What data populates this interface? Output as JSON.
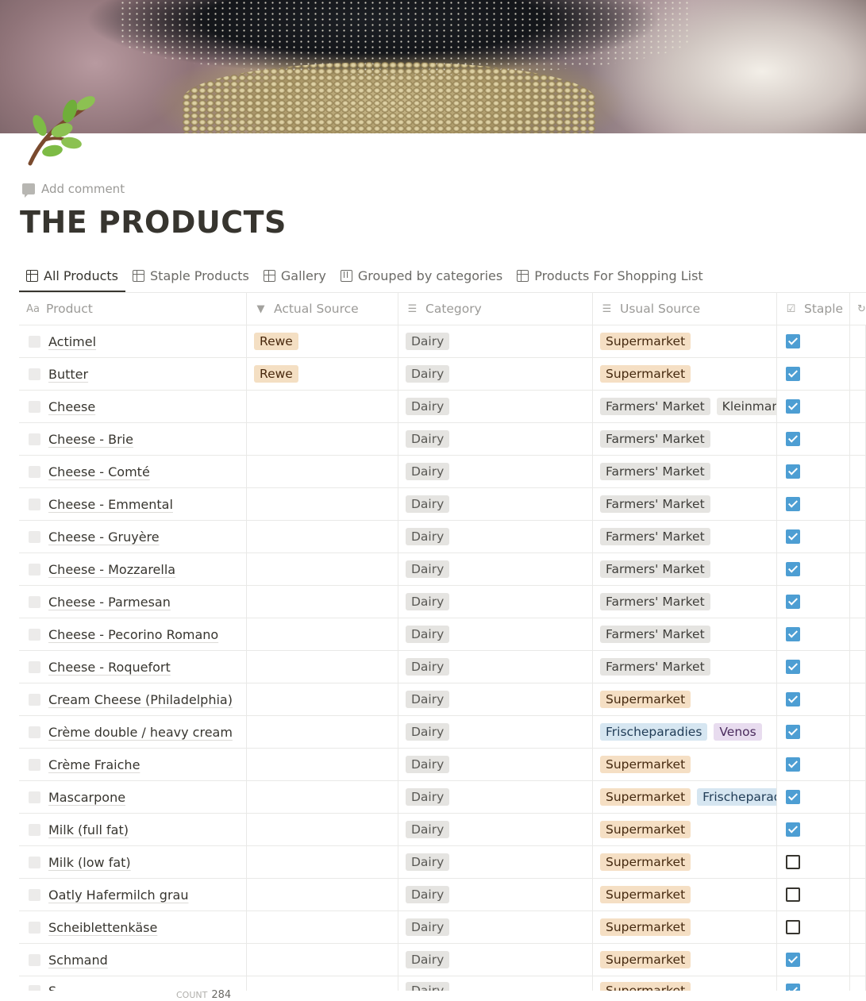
{
  "page": {
    "add_comment": "Add comment",
    "title": "THE PRODUCTS",
    "cover_icon": "herb-branch-icon"
  },
  "tabs": [
    {
      "label": "All Products",
      "icon": "table-icon",
      "active": true
    },
    {
      "label": "Staple Products",
      "icon": "table-icon",
      "active": false
    },
    {
      "label": "Gallery",
      "icon": "gallery-icon",
      "active": false
    },
    {
      "label": "Grouped by categories",
      "icon": "board-icon",
      "active": false
    },
    {
      "label": "Products For Shopping List",
      "icon": "table-icon",
      "active": false
    }
  ],
  "columns": {
    "product": "Product",
    "actual_source": "Actual Source",
    "category": "Category",
    "usual_source": "Usual Source",
    "staple": "Staple"
  },
  "rows": [
    {
      "name": "Actimel",
      "actual": [
        "Rewe"
      ],
      "category": "Dairy",
      "usual": [
        "Supermarket"
      ],
      "staple": true
    },
    {
      "name": "Butter",
      "actual": [
        "Rewe"
      ],
      "category": "Dairy",
      "usual": [
        "Supermarket"
      ],
      "staple": true
    },
    {
      "name": "Cheese",
      "actual": [],
      "category": "Dairy",
      "usual": [
        "Farmers' Market",
        "Kleinmarkt"
      ],
      "staple": true
    },
    {
      "name": "Cheese - Brie",
      "actual": [],
      "category": "Dairy",
      "usual": [
        "Farmers' Market"
      ],
      "staple": true
    },
    {
      "name": "Cheese - Comté",
      "actual": [],
      "category": "Dairy",
      "usual": [
        "Farmers' Market"
      ],
      "staple": true
    },
    {
      "name": "Cheese - Emmental",
      "actual": [],
      "category": "Dairy",
      "usual": [
        "Farmers' Market"
      ],
      "staple": true
    },
    {
      "name": "Cheese - Gruyère",
      "actual": [],
      "category": "Dairy",
      "usual": [
        "Farmers' Market"
      ],
      "staple": true
    },
    {
      "name": "Cheese - Mozzarella",
      "actual": [],
      "category": "Dairy",
      "usual": [
        "Farmers' Market"
      ],
      "staple": true
    },
    {
      "name": "Cheese - Parmesan",
      "actual": [],
      "category": "Dairy",
      "usual": [
        "Farmers' Market"
      ],
      "staple": true
    },
    {
      "name": "Cheese - Pecorino Romano",
      "actual": [],
      "category": "Dairy",
      "usual": [
        "Farmers' Market"
      ],
      "staple": true
    },
    {
      "name": "Cheese - Roquefort",
      "actual": [],
      "category": "Dairy",
      "usual": [
        "Farmers' Market"
      ],
      "staple": true
    },
    {
      "name": "Cream Cheese (Philadelphia)",
      "actual": [],
      "category": "Dairy",
      "usual": [
        "Supermarket"
      ],
      "staple": true
    },
    {
      "name": "Crème double / heavy cream",
      "actual": [],
      "category": "Dairy",
      "usual": [
        "Frischeparadies",
        "Venos"
      ],
      "staple": true
    },
    {
      "name": "Crème Fraiche",
      "actual": [],
      "category": "Dairy",
      "usual": [
        "Supermarket"
      ],
      "staple": true
    },
    {
      "name": "Mascarpone",
      "actual": [],
      "category": "Dairy",
      "usual": [
        "Supermarket",
        "Frischeparadies"
      ],
      "staple": true
    },
    {
      "name": "Milk (full fat)",
      "actual": [],
      "category": "Dairy",
      "usual": [
        "Supermarket"
      ],
      "staple": true
    },
    {
      "name": "Milk (low fat)",
      "actual": [],
      "category": "Dairy",
      "usual": [
        "Supermarket"
      ],
      "staple": false
    },
    {
      "name": "Oatly Hafermilch grau",
      "actual": [],
      "category": "Dairy",
      "usual": [
        "Supermarket"
      ],
      "staple": false
    },
    {
      "name": "Scheiblettenkäse",
      "actual": [],
      "category": "Dairy",
      "usual": [
        "Supermarket"
      ],
      "staple": false
    },
    {
      "name": "Schmand",
      "actual": [],
      "category": "Dairy",
      "usual": [
        "Supermarket"
      ],
      "staple": true
    },
    {
      "name": "S",
      "actual": [],
      "category": "Dairy",
      "usual": [
        "Supermarket"
      ],
      "staple": true
    }
  ],
  "footer": {
    "count_label": "COUNT",
    "count_value": "284"
  },
  "colors": {
    "checkbox_checked": "#4d9ed3",
    "tag_supermarket": "#f5dfc4",
    "tag_dairy": "#e5e4e1",
    "tag_frischeparadies": "#d6e6f1",
    "tag_venos": "#e8dcef"
  }
}
